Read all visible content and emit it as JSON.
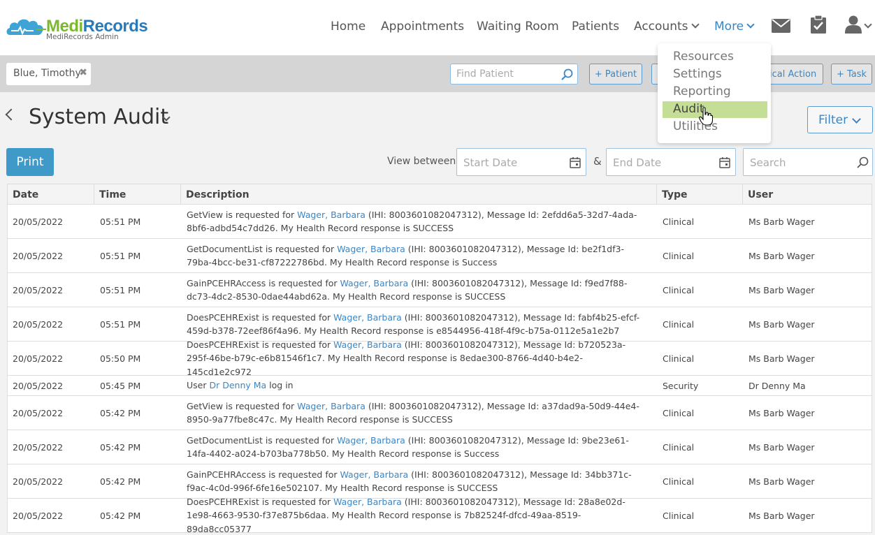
{
  "app": {
    "logo_medi": "Medi",
    "logo_records": "Records",
    "logo_sub": "MediRecords Admin"
  },
  "nav": {
    "home": "Home",
    "appointments": "Appointments",
    "waiting_room": "Waiting Room",
    "patients": "Patients",
    "accounts": "Accounts",
    "more": "More"
  },
  "patient_bar": {
    "current_patient": "Blue, Timothy",
    "close_glyph": "✖",
    "find_patient_placeholder": "Find Patient",
    "add_patient": "+ Patient",
    "clinical_action_partial": "ical Action",
    "add_task": "+ Task"
  },
  "dropdown": {
    "items": [
      "Resources",
      "Settings",
      "Reporting",
      "Audit",
      "Utilities"
    ],
    "active": "Audit"
  },
  "page": {
    "title": "System Audit",
    "filter_label": "Filter",
    "print_label": "Print",
    "view_between": "View between",
    "start_date_placeholder": "Start Date",
    "amp": "&",
    "end_date_placeholder": "End Date",
    "search_placeholder": "Search"
  },
  "table": {
    "headers": [
      "Date",
      "Time",
      "Description",
      "Type",
      "User"
    ],
    "rows": [
      {
        "date": "20/05/2022",
        "time": "05:51 PM",
        "pre": "GetView is requested for ",
        "link": "Wager, Barbara",
        "post": " (IHI: 8003601082047312), Message Id: 2efdd6a5-32d7-4ada-8bf6-adbd54c7dd26. My Health Record response is SUCCESS",
        "type": "Clinical",
        "user": "Ms Barb Wager",
        "tall": true
      },
      {
        "date": "20/05/2022",
        "time": "05:51 PM",
        "pre": "GetDocumentList is requested for ",
        "link": "Wager, Barbara",
        "post": " (IHI: 8003601082047312), Message Id: be2f1df3-79ba-4bcc-be31-cf87222786bd. My Health Record response is Success",
        "type": "Clinical",
        "user": "Ms Barb Wager",
        "tall": true
      },
      {
        "date": "20/05/2022",
        "time": "05:51 PM",
        "pre": "GainPCEHRAccess is requested for ",
        "link": "Wager, Barbara",
        "post": " (IHI: 8003601082047312), Message Id: f9ed7f88-dc73-4dc2-8530-0dae44abd62a. My Health Record response is SUCCESS",
        "type": "Clinical",
        "user": "Ms Barb Wager",
        "tall": true
      },
      {
        "date": "20/05/2022",
        "time": "05:51 PM",
        "pre": "DoesPCEHRExist is requested for ",
        "link": "Wager, Barbara",
        "post": " (IHI: 8003601082047312), Message Id: fabf4b25-efcf-459d-b378-72eef86f4a96. My Health Record response is e8544956-418f-4f9c-b75a-0112e5a1e2b7",
        "type": "Clinical",
        "user": "Ms Barb Wager",
        "tall": true
      },
      {
        "date": "20/05/2022",
        "time": "05:50 PM",
        "pre": "DoesPCEHRExist is requested for ",
        "link": "Wager, Barbara",
        "post": " (IHI: 8003601082047312), Message Id: b720523a-295f-46be-b79c-e6b81546f1c7. My Health Record response is 8edae300-8766-4d40-b4e2-145cd1e2c972",
        "type": "Clinical",
        "user": "Ms Barb Wager",
        "tall": true
      },
      {
        "date": "20/05/2022",
        "time": "05:45 PM",
        "pre": "User ",
        "link": "Dr Denny Ma",
        "post": " log in",
        "type": "Security",
        "user": "Dr Denny Ma",
        "tall": false
      },
      {
        "date": "20/05/2022",
        "time": "05:42 PM",
        "pre": "GetView is requested for ",
        "link": "Wager, Barbara",
        "post": " (IHI: 8003601082047312), Message Id: a37dad9a-50d9-44e4-8950-9a77fbe8c47c. My Health Record response is SUCCESS",
        "type": "Clinical",
        "user": "Ms Barb Wager",
        "tall": true
      },
      {
        "date": "20/05/2022",
        "time": "05:42 PM",
        "pre": "GetDocumentList is requested for ",
        "link": "Wager, Barbara",
        "post": " (IHI: 8003601082047312), Message Id: 9be23e61-14fa-4402-a024-b703ba778b50. My Health Record response is Success",
        "type": "Clinical",
        "user": "Ms Barb Wager",
        "tall": true
      },
      {
        "date": "20/05/2022",
        "time": "05:42 PM",
        "pre": "GainPCEHRAccess is requested for ",
        "link": "Wager, Barbara",
        "post": " (IHI: 8003601082047312), Message Id: 34bb371c-f9ac-4c0d-996f-6fe16e502107. My Health Record response is SUCCESS",
        "type": "Clinical",
        "user": "Ms Barb Wager",
        "tall": true
      },
      {
        "date": "20/05/2022",
        "time": "05:42 PM",
        "pre": "DoesPCEHRExist is requested for ",
        "link": "Wager, Barbara",
        "post": " (IHI: 8003601082047312), Message Id: 28a8e02d-1e98-4663-9530-f37e875b6daa. My Health Record response is 7b82524f-dfcd-49aa-8519-89da8cc05377",
        "type": "Clinical",
        "user": "Ms Barb Wager",
        "tall": true
      }
    ]
  },
  "colors": {
    "accent": "#3a86c6",
    "print_button": "#3f9ac9",
    "menu_active": "#c4df95",
    "logo_green": "#7ab82f",
    "logo_blue": "#2a7ab8"
  },
  "icons": [
    "logo-cloud-icon",
    "mail-icon",
    "clipboard-check-icon",
    "user-icon",
    "search-icon",
    "calendar-icon",
    "chevron-down-icon",
    "chevron-left-icon",
    "close-icon",
    "hand-cursor-icon"
  ]
}
